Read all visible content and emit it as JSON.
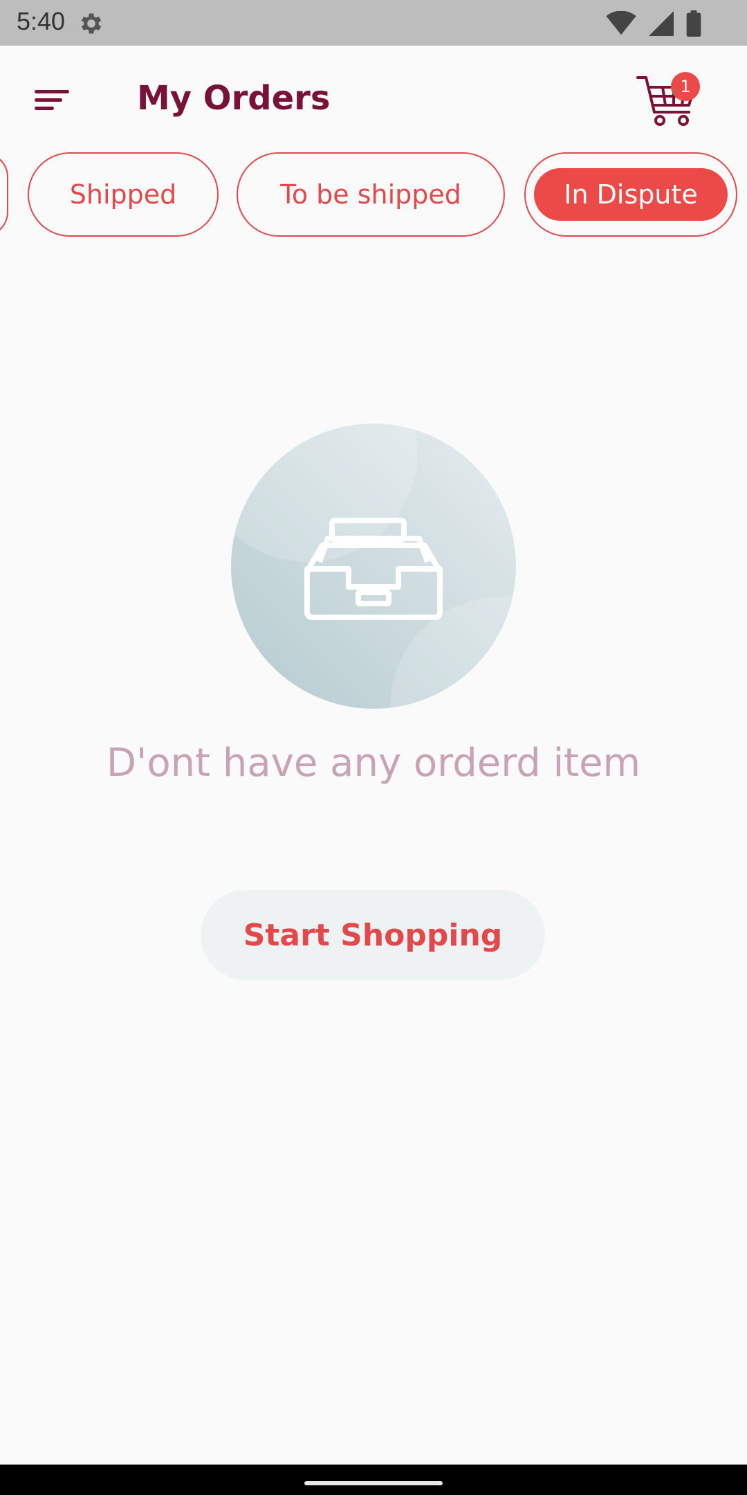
{
  "status_bar": {
    "time": "5:40",
    "icons": [
      "settings-icon",
      "wifi-icon",
      "signal-icon",
      "battery-icon"
    ]
  },
  "header": {
    "title": "My Orders",
    "menu_icon": "menu-icon",
    "cart_icon": "shopping-cart-icon",
    "cart_badge_count": "1"
  },
  "filters": {
    "selected": "In Dispute",
    "chips": [
      {
        "label": "Shipped"
      },
      {
        "label": "To be shipped"
      },
      {
        "label": "In Dispute"
      }
    ]
  },
  "empty_state": {
    "icon": "inbox-tray-icon",
    "message": "D'ont have any orderd item",
    "button_label": "Start Shopping"
  },
  "colors": {
    "primary_dark": "#7a1238",
    "accent_red": "#ec4a48",
    "chip_border": "#e3484b",
    "message_text": "#c9a3b3",
    "button_bg": "#eff2f3",
    "background": "#fafafa"
  }
}
